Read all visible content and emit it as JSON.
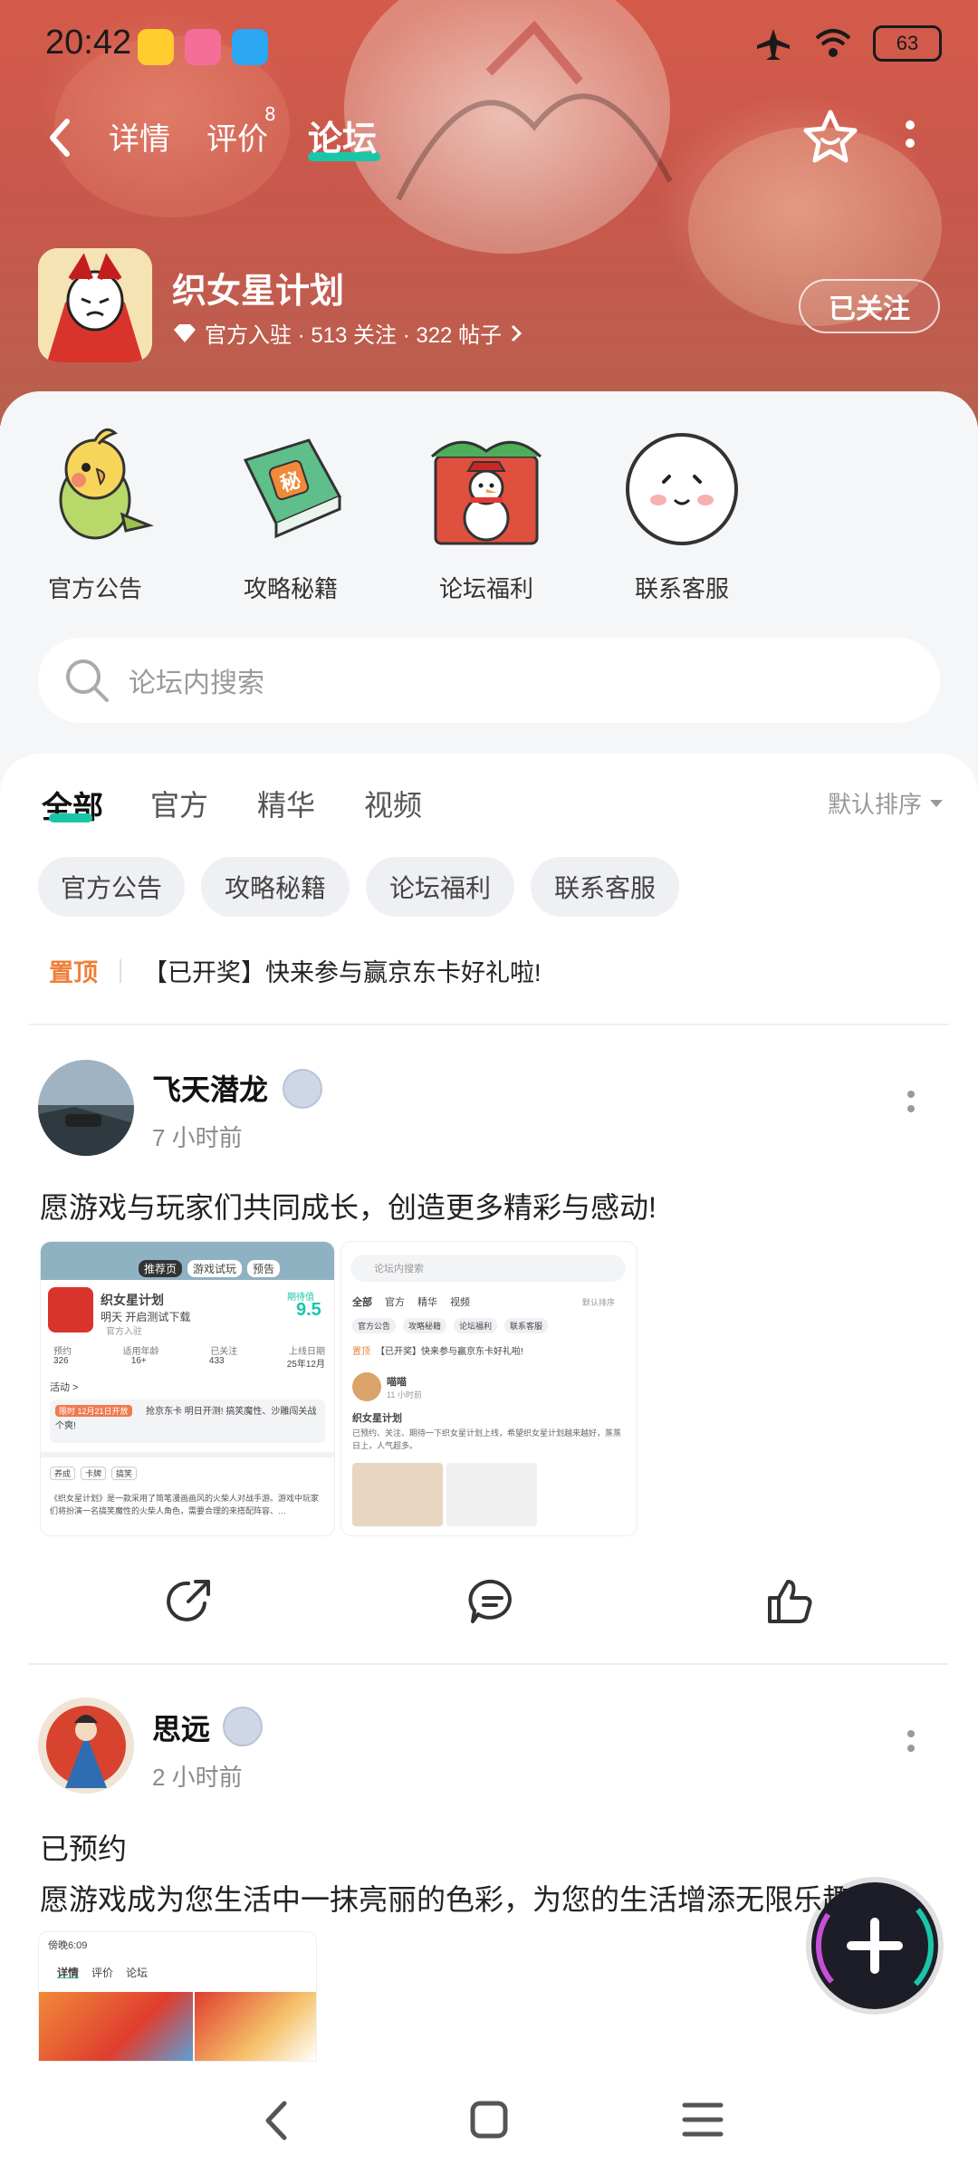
{
  "status_bar": {
    "time": "20:42",
    "battery": "63",
    "icons": [
      "weibo-icon",
      "bilibili-icon",
      "qq-icon",
      "airplane-icon",
      "wifi-icon",
      "battery-icon"
    ]
  },
  "nav": {
    "tabs": [
      {
        "label": "详情"
      },
      {
        "label": "评价",
        "count": "8"
      },
      {
        "label": "论坛",
        "active": true
      }
    ]
  },
  "game": {
    "title": "织女星计划",
    "meta": "官方入驻 · 513 关注 · 322 帖子",
    "follow_label": "已关注"
  },
  "quick_links": [
    {
      "label": "官方公告",
      "icon": "parrot-icon"
    },
    {
      "label": "攻略秘籍",
      "icon": "secret-book-icon"
    },
    {
      "label": "论坛福利",
      "icon": "gift-snowman-icon"
    },
    {
      "label": "联系客服",
      "icon": "mochi-face-icon"
    }
  ],
  "search": {
    "placeholder": "论坛内搜索"
  },
  "feed_tabs": [
    {
      "label": "全部",
      "active": true
    },
    {
      "label": "官方"
    },
    {
      "label": "精华"
    },
    {
      "label": "视频"
    }
  ],
  "sort_label": "默认排序",
  "chips": [
    "官方公告",
    "攻略秘籍",
    "论坛福利",
    "联系客服"
  ],
  "pinned": {
    "tag": "置顶",
    "text": "【已开奖】快来参与赢京东卡好礼啦!"
  },
  "posts": [
    {
      "user": "飞天潜龙",
      "time": "7 小时前",
      "text": "愿游戏与玩家们共同成长，创造更多精彩与感动!",
      "thumb1": {
        "chips": [
          "推荐页",
          "游戏试玩",
          "预告"
        ],
        "title": "织女星计划",
        "score_label": "期待值",
        "score": "9.5",
        "subtitle": "明天 开启测试下载",
        "official": "官方入驻",
        "stats_labels": [
          "预约",
          "适用年龄",
          "已关注",
          "上线日期"
        ],
        "stats_values": [
          "326",
          "16+",
          "433",
          "25年12月"
        ],
        "activity": "活动 >",
        "banner_tag": "限时 12月21日开放",
        "banner_text": "抢京东卡 明日开测! 搞笑魔性、沙雕闯关战个爽!",
        "tags": [
          "养成",
          "卡牌",
          "搞笑"
        ],
        "desc": "《织女星计划》是一款采用了简笔漫画画风的火柴人对战手游。游戏中玩家们将扮演一名搞笑魔性的火柴人角色，需要合理的来搭配阵容、…"
      },
      "thumb2": {
        "search_placeholder": "论坛内搜索",
        "tabs": [
          "全部",
          "官方",
          "精华",
          "视频"
        ],
        "sort": "默认排序",
        "chips": [
          "官方公告",
          "攻略秘籍",
          "论坛福利",
          "联系客服"
        ],
        "pinned_tag": "置顶",
        "pinned_text": "【已开奖】快来参与赢京东卡好礼啦!",
        "user": "喵喵",
        "time": "11 小时前",
        "title": "织女星计划",
        "body": "已预约、关注、期待一下织女星计划上线，希望织女星计划越来越好，蒸蒸日上，人气超多。"
      }
    },
    {
      "user": "思远",
      "time": "2 小时前",
      "text_line1": "已预约",
      "text_line2": "愿游戏成为您生活中一抹亮丽的色彩，为您的生活增添无限乐趣",
      "thumb": {
        "status_time": "傍晚6:09",
        "tabs": [
          "详情",
          "评价",
          "论坛"
        ]
      }
    }
  ],
  "colors": {
    "accent": "#19c7a8",
    "banner": "#c9584c",
    "pinned": "#ef7f3a"
  }
}
